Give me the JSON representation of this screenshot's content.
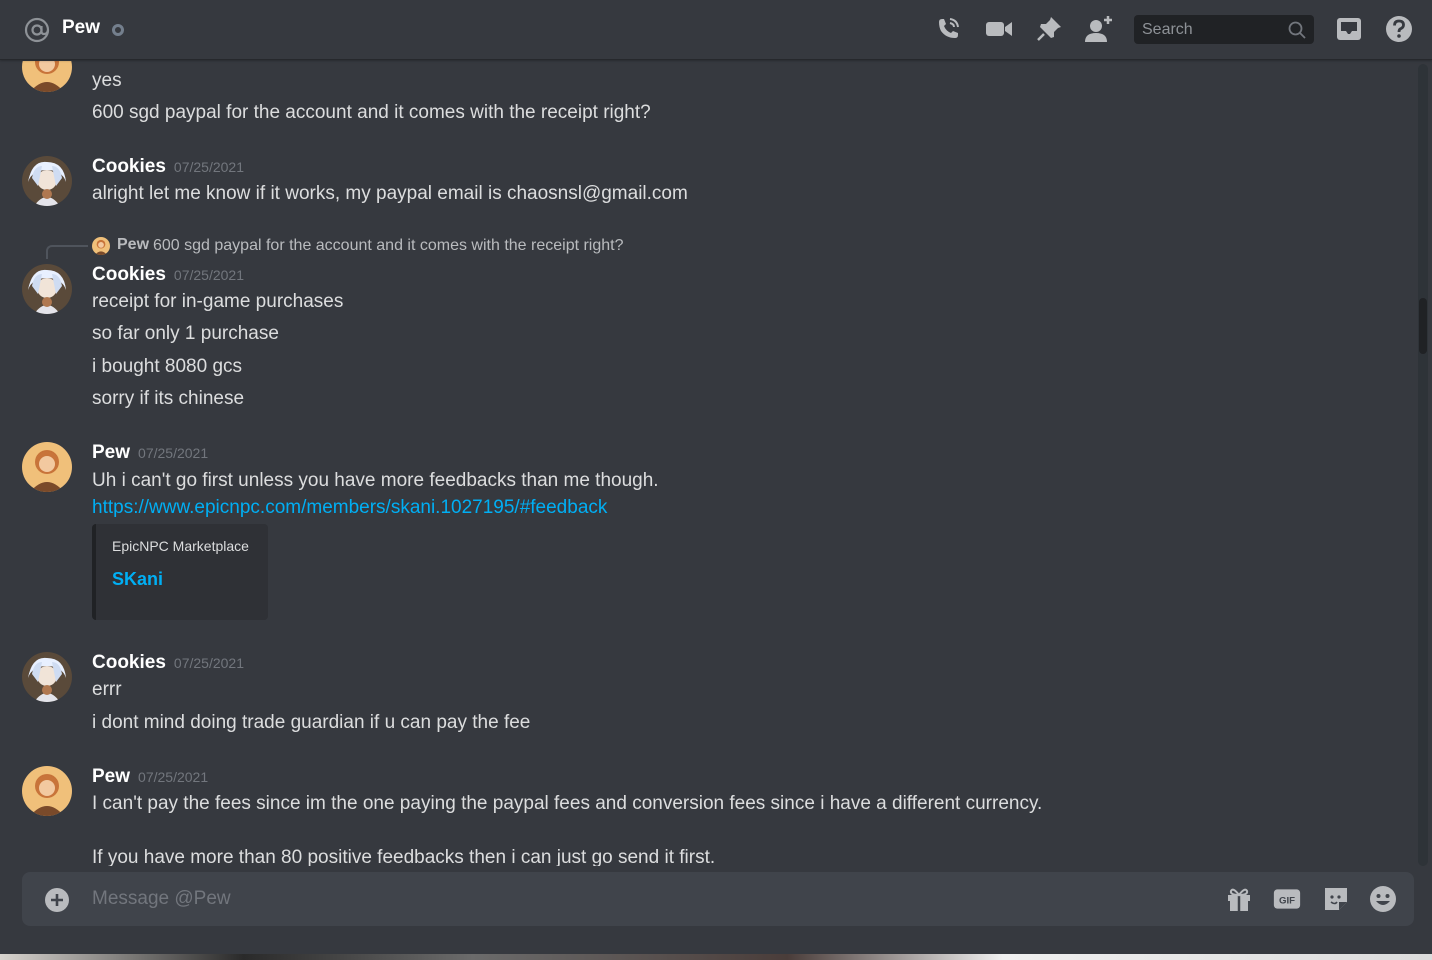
{
  "header": {
    "channel_name": "Pew",
    "search_placeholder": "Search",
    "icons": [
      "at-icon",
      "phone-call-icon",
      "video-icon",
      "pin-icon",
      "add-friend-icon",
      "search-icon",
      "inbox-icon",
      "help-icon"
    ]
  },
  "colors": {
    "background": "#36393f",
    "composer": "#40444b",
    "link": "#00aff4",
    "timestamp": "#72767d"
  },
  "messages": [
    {
      "lines": [
        "yes",
        "600 sgd paypal for the account and it comes with the receipt right?"
      ]
    },
    {
      "author": "Cookies",
      "timestamp": "07/25/2021",
      "lines": [
        "alright let me know if it works, my paypal email is chaosnsl@gmail.com"
      ]
    },
    {
      "reply": {
        "author": "Pew",
        "text": "600 sgd paypal for the account and it comes with the receipt right?"
      },
      "author": "Cookies",
      "timestamp": "07/25/2021",
      "lines": [
        "receipt for in-game purchases",
        "so far only 1 purchase",
        "i bought 8080 gcs",
        "sorry if its chinese"
      ]
    },
    {
      "author": "Pew",
      "timestamp": "07/25/2021",
      "lines": [
        "Uh i can't go first unless you have more feedbacks than me though."
      ],
      "link": "https://www.epicnpc.com/members/skani.1027195/#feedback",
      "embed": {
        "provider": "EpicNPC Marketplace",
        "title": "SKani"
      }
    },
    {
      "author": "Cookies",
      "timestamp": "07/25/2021",
      "lines": [
        "errr",
        "i dont mind doing trade guardian if u can pay the fee"
      ]
    },
    {
      "author": "Pew",
      "timestamp": "07/25/2021",
      "lines": [
        "I can't pay the fees since im the one paying the paypal fees and conversion fees since i have a different currency.",
        "If you have more than 80 positive feedbacks then i can just go send it first."
      ]
    }
  ],
  "composer": {
    "placeholder": "Message @Pew",
    "icons": [
      "add-icon",
      "gift-icon",
      "gif-icon",
      "sticker-icon",
      "emoji-icon"
    ]
  }
}
